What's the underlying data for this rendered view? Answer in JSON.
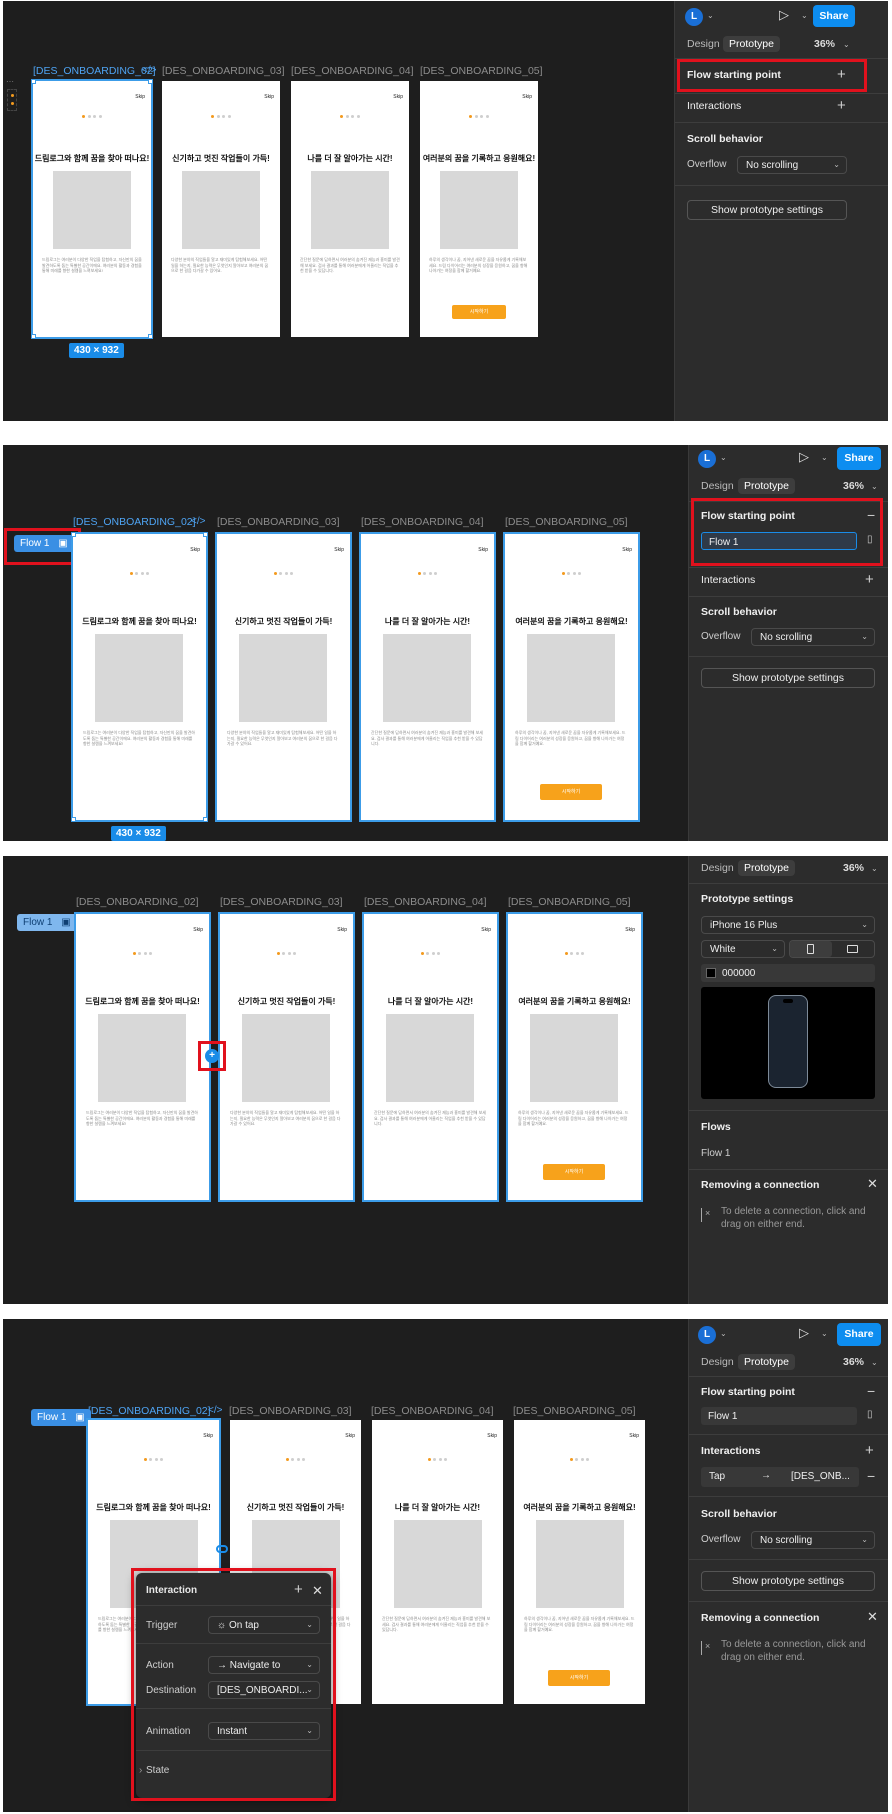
{
  "frame_labels": [
    "[DES_ONBOARDING_02]",
    "[DES_ONBOARDING_03]",
    "[DES_ONBOARDING_04]",
    "[DES_ONBOARDING_05]"
  ],
  "code_icon": "</>",
  "frames": [
    {
      "skip": "Skip",
      "headline": "드림로그와 함께 꿈을 찾아 떠나요!",
      "body": "드림로그는 여러분이 다양한 직업을 탐험하고, 자신만의 꿈을 발견하도록 돕는 특별한 공간이에요. 여러분의 활동과 경험을 통해 미래를 향한 설렘을 느껴보세요!",
      "cta": ""
    },
    {
      "skip": "Skip",
      "headline": "신기하고 멋진 작업들이 가득!",
      "body": "다양한 분야의 직업들을 알고 재미있게 탐험해보세요. 어떤 일을 하는지, 필요한 능력은 무엇인지 알아보고 여러분의 꿈으로 한 걸음 다가갈 수 있어요.",
      "cta": ""
    },
    {
      "skip": "Skip",
      "headline": "나를 더 잘 알아가는 시간!",
      "body": "간단한 질문에 답하면서 여러분의 숨겨진 재능과 흥미를 발견해 보세요. 검사 결과를 통해 여러분에게 어울리는 직업을 추천 받을 수 있답니다.",
      "cta": ""
    },
    {
      "skip": "Skip",
      "headline": "여러분의 꿈을 기록하고 응원해요!",
      "body": "하루의 생각이나 꿈, 지어낸 새로운 꿈을 자유롭게 기록해보세요. 드림 다이어리는 여러분의 성장을 응원하고, 꿈을 향해 나아가는 여정을 함께 할거예요.",
      "cta": "시작하기"
    }
  ],
  "dimension": "430 × 932",
  "sidebar": {
    "avatar": "L",
    "share": "Share",
    "tabs": {
      "design": "Design",
      "prototype": "Prototype"
    },
    "zoom": "36%",
    "flow_starting_point": "Flow starting point",
    "flow_name": "Flow 1",
    "interactions": "Interactions",
    "interaction_row": {
      "trigger": "Tap",
      "target": "[DES_ONB..."
    },
    "scroll_behavior": "Scroll behavior",
    "overflow_label": "Overflow",
    "overflow_value": "No scrolling",
    "show_settings": "Show prototype settings",
    "prototype_settings": "Prototype settings",
    "device": "iPhone 16 Plus",
    "device_color": "White",
    "bg_color": "000000",
    "flows": "Flows",
    "flows_item": "Flow 1",
    "removing_title": "Removing a connection",
    "removing_hint_1": "To delete a connection, click and",
    "removing_hint_2": "drag on either end."
  },
  "flow_tag": "Flow 1",
  "popup": {
    "title": "Interaction",
    "trigger_label": "Trigger",
    "trigger_value": "On tap",
    "action_label": "Action",
    "action_value": "Navigate to",
    "destination_label": "Destination",
    "destination_value": "[DES_ONBOARDI...",
    "animation_label": "Animation",
    "animation_value": "Instant",
    "state_label": "State"
  },
  "colors": {
    "accent": "#0d8df0",
    "highlight": "#e1111d",
    "cta": "#f7a21b",
    "canvas": "#1e1e1e",
    "panel": "#2c2c2c"
  }
}
